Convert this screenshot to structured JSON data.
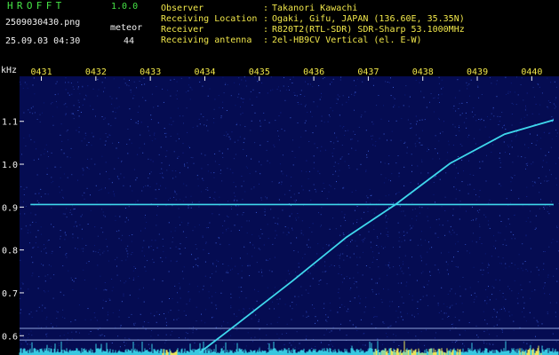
{
  "header": {
    "app_title": "HROFFT",
    "app_version": "1.0.0",
    "filename": "2509030430.png",
    "mode": "meteor",
    "datetime": "25.09.03 04:30",
    "count": "44",
    "meta": [
      {
        "label": "Observer",
        "value": "Takanori Kawachi"
      },
      {
        "label": "Receiving Location",
        "value": "Ogaki, Gifu, JAPAN (136.60E, 35.35N)"
      },
      {
        "label": "Receiver",
        "value": "R820T2(RTL-SDR) SDR-Sharp 53.1000MHz"
      },
      {
        "label": "Receiving antenna",
        "value": "2el-HB9CV Vertical (el. E-W)"
      }
    ]
  },
  "chart_data": {
    "type": "spectrogram",
    "ylabel": "kHz",
    "xlabel": "",
    "title": "",
    "x_ticks": [
      "0431",
      "0432",
      "0433",
      "0434",
      "0435",
      "0436",
      "0437",
      "0438",
      "0439",
      "0440"
    ],
    "x_range": [
      430.6,
      440.5
    ],
    "y_ticks": [
      0.6,
      0.7,
      0.8,
      0.9,
      1.0,
      1.1
    ],
    "y_range": [
      0.555,
      1.205
    ],
    "background_color": "#050c52",
    "signal_color": "#3fd8ec",
    "horizontal_line": {
      "y": 0.906,
      "x_start": 430.8,
      "x_end": 440.4
    },
    "reference_lines": [
      0.617,
      0.59
    ],
    "traces": [
      {
        "points": [
          [
            433.9,
            0.56
          ],
          [
            434.6,
            0.628
          ],
          [
            435.6,
            0.727
          ],
          [
            436.6,
            0.83
          ],
          [
            437.5,
            0.906
          ],
          [
            438.5,
            1.002
          ],
          [
            439.5,
            1.07
          ],
          [
            440.4,
            1.103
          ]
        ]
      }
    ]
  }
}
